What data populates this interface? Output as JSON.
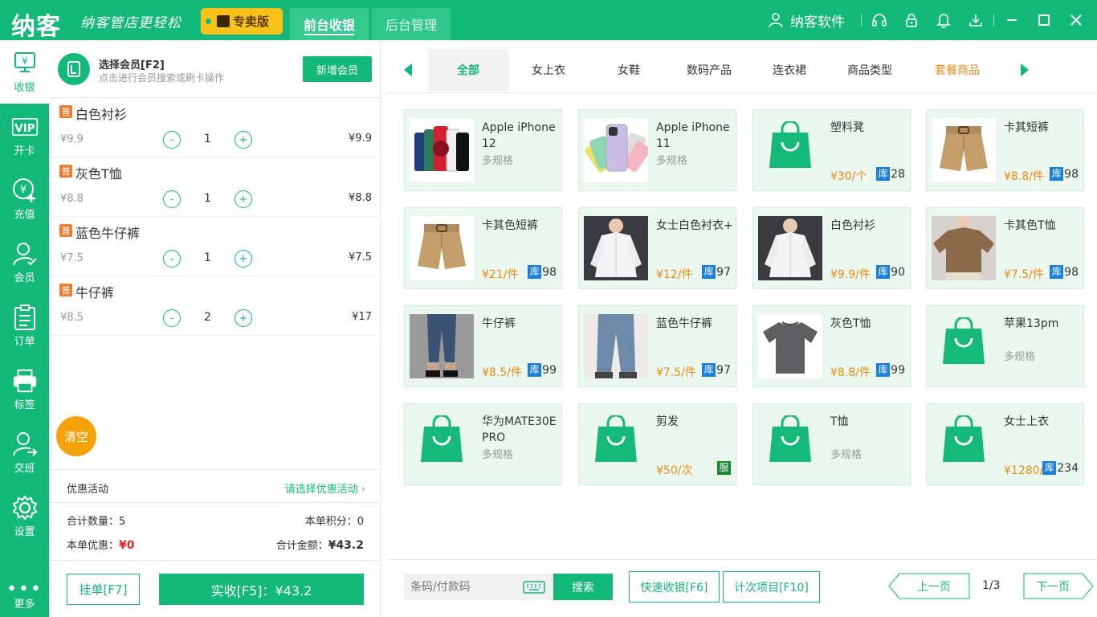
{
  "header": {
    "logo": "纳客",
    "slogan": "纳客管店更轻松",
    "edition": "专卖版",
    "tabs": [
      {
        "label": "前台收银"
      },
      {
        "label": "后台管理"
      }
    ],
    "user": "纳客软件"
  },
  "sidebar": {
    "items": [
      {
        "label": "收银",
        "icon": "cashier-icon"
      },
      {
        "label": "开卡",
        "icon": "vip-card-icon"
      },
      {
        "label": "充值",
        "icon": "recharge-icon"
      },
      {
        "label": "会员",
        "icon": "member-icon"
      },
      {
        "label": "订单",
        "icon": "order-icon"
      },
      {
        "label": "标签",
        "icon": "printer-icon"
      },
      {
        "label": "交班",
        "icon": "handover-icon"
      },
      {
        "label": "设置",
        "icon": "gear-icon"
      }
    ],
    "more": "更多"
  },
  "member": {
    "title": "选择会员[F2]",
    "subtitle": "点击进行会员搜索或刷卡操作",
    "add_label": "新增会员"
  },
  "cart": {
    "tag": "普",
    "items": [
      {
        "name": "白色衬衫",
        "price": "¥9.9",
        "qty": "1",
        "subtotal": "¥9.9"
      },
      {
        "name": "灰色T恤",
        "price": "¥8.8",
        "qty": "1",
        "subtotal": "¥8.8"
      },
      {
        "name": "蓝色牛仔裤",
        "price": "¥7.5",
        "qty": "1",
        "subtotal": "¥7.5"
      },
      {
        "name": "牛仔裤",
        "price": "¥8.5",
        "qty": "2",
        "subtotal": "¥17"
      }
    ],
    "minus": "-",
    "plus": "+",
    "clear_label": "清空"
  },
  "promo": {
    "label": "优惠活动",
    "action": "请选择优惠活动"
  },
  "summary": {
    "count_label": "合计数量：",
    "count": "5",
    "points_label": "本单积分：",
    "points": "0",
    "discount_label": "本单优惠：",
    "discount": "¥0",
    "total_label": "合计金额：",
    "total": "¥43.2"
  },
  "actions": {
    "hang": "挂单[F7]",
    "pay": "实收[F5]：¥43.2"
  },
  "categories": {
    "items": [
      {
        "label": "全部"
      },
      {
        "label": "女上衣"
      },
      {
        "label": "女鞋"
      },
      {
        "label": "数码产品"
      },
      {
        "label": "连衣裙"
      },
      {
        "label": "商品类型"
      },
      {
        "label": "套餐商品"
      }
    ]
  },
  "products": [
    {
      "name": "Apple iPhone 12",
      "spec": "多规格",
      "img": "iphone12"
    },
    {
      "name": "Apple iPhone 11",
      "spec": "多规格",
      "img": "iphone11"
    },
    {
      "name": "塑料凳",
      "price": "¥30/个",
      "stock": "28",
      "img": "bag"
    },
    {
      "name": "卡其短裤",
      "price": "¥8.8/件",
      "stock": "98",
      "img": "shorts"
    },
    {
      "name": "卡其色短裤",
      "price": "¥21/件",
      "stock": "98",
      "img": "shorts"
    },
    {
      "name": "女士白色衬衣+",
      "price": "¥12/件",
      "stock": "97",
      "img": "shirt"
    },
    {
      "name": "白色衬衫",
      "price": "¥9.9/件",
      "stock": "90",
      "img": "shirt"
    },
    {
      "name": "卡其色T恤",
      "price": "¥7.5/件",
      "stock": "98",
      "img": "khakitee"
    },
    {
      "name": "牛仔裤",
      "price": "¥8.5/件",
      "stock": "99",
      "img": "jeans"
    },
    {
      "name": "蓝色牛仔裤",
      "price": "¥7.5/件",
      "stock": "97",
      "img": "jeans2"
    },
    {
      "name": "灰色T恤",
      "price": "¥8.8/件",
      "stock": "99",
      "img": "greytee"
    },
    {
      "name": "苹果13pm",
      "spec": "多规格",
      "img": "bag"
    },
    {
      "name": "华为MATE30E PRO",
      "spec": "多规格",
      "img": "bag"
    },
    {
      "name": "剪发",
      "price": "¥50/次",
      "service": "服",
      "img": "bag"
    },
    {
      "name": "T恤",
      "spec": "多规格",
      "img": "bag"
    },
    {
      "name": "女士上衣",
      "price": "¥1280/件",
      "stock": "234",
      "img": "bag"
    }
  ],
  "stock_tag": "库",
  "bottom": {
    "search_placeholder": "条码/付款码",
    "search_label": "搜索",
    "quick_label": "快速收银[F6]",
    "count_label": "计次项目[F10]",
    "prev": "上一页",
    "next": "下一页",
    "page": "1/3"
  },
  "colors": {
    "brand": "#12b979",
    "price": "#ef8a14",
    "stock": "#1b7fe0",
    "edition": "#f9c21a",
    "clear": "#f5a10a"
  }
}
